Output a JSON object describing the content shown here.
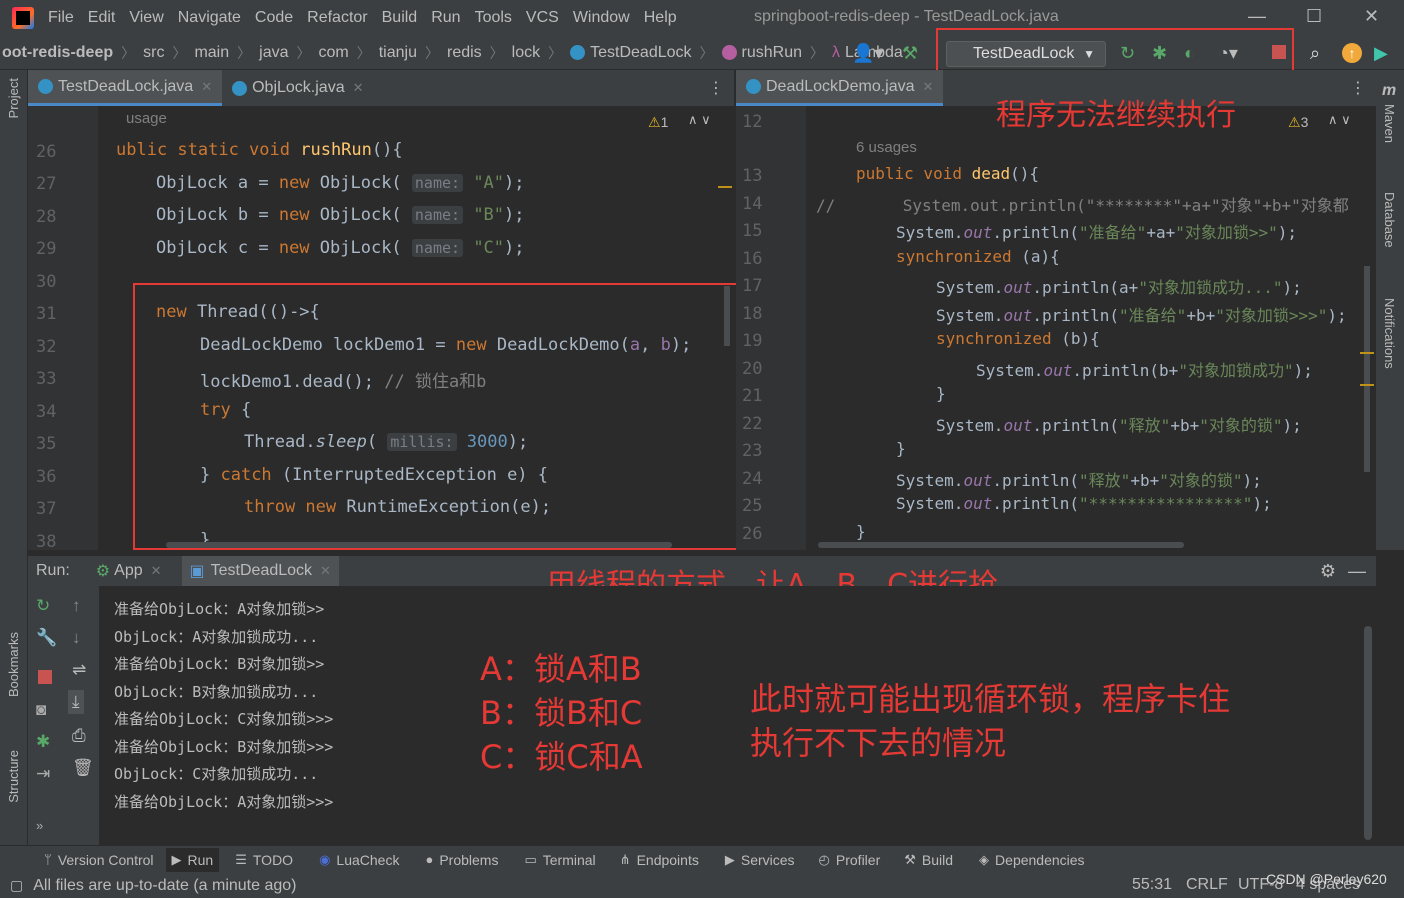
{
  "menu": {
    "items": [
      "File",
      "Edit",
      "View",
      "Navigate",
      "Code",
      "Refactor",
      "Build",
      "Run",
      "Tools",
      "VCS",
      "Window",
      "Help"
    ],
    "window_title": "springboot-redis-deep - TestDeadLock.java"
  },
  "breadcrumb": [
    "oot-redis-deep",
    "src",
    "main",
    "java",
    "com",
    "tianju",
    "redis",
    "lock",
    "TestDeadLock",
    "rushRun",
    "Lambda"
  ],
  "run_config": "TestDeadLock",
  "left_tabs": [
    {
      "label": "TestDeadLock.java"
    },
    {
      "label": "ObjLock.java"
    }
  ],
  "right_tabs": [
    {
      "label": "DeadLockDemo.java"
    }
  ],
  "left_editor": {
    "usage": "usage",
    "warn": "1",
    "lines": [
      "26",
      "27",
      "28",
      "29",
      "30",
      "31",
      "32",
      "33",
      "34",
      "35",
      "36",
      "37",
      "38"
    ]
  },
  "right_editor": {
    "usages": "6 usages",
    "warn": "3",
    "lines": [
      "12",
      "13",
      "14",
      "15",
      "16",
      "17",
      "18",
      "19",
      "20",
      "21",
      "22",
      "23",
      "24",
      "25",
      "26"
    ]
  },
  "annotations": {
    "top": "程序无法继续执行",
    "mid": "用线程的方式，让A、B、C进行抢",
    "a": "A：锁A和B",
    "b": "B：锁B和C",
    "c": "C：锁C和A",
    "note1": "此时就可能出现循环锁，程序卡住",
    "note2": "执行不下去的情况"
  },
  "run": {
    "label": "Run:",
    "tabs": [
      "App",
      "TestDeadLock"
    ]
  },
  "console": [
    "准备给ObjLock：A对象加锁>>",
    "ObjLock：A对象加锁成功...",
    "准备给ObjLock：B对象加锁>>",
    "ObjLock：B对象加锁成功...",
    "准备给ObjLock：C对象加锁>>>",
    "准备给ObjLock：B对象加锁>>>",
    "ObjLock：C对象加锁成功...",
    "准备给ObjLock：A对象加锁>>>"
  ],
  "bottom_tools": [
    "Version Control",
    "Run",
    "TODO",
    "LuaCheck",
    "Problems",
    "Terminal",
    "Endpoints",
    "Services",
    "Profiler",
    "Build",
    "Dependencies"
  ],
  "status": {
    "message": "All files are up-to-date (a minute ago)",
    "pos": "55:31",
    "eol": "CRLF",
    "enc": "UTF-8",
    "indent": "4 spaces",
    "watermark": "CSDN @Perley620"
  },
  "side": {
    "project": "Project",
    "bookmarks": "Bookmarks",
    "structure": "Structure",
    "maven": "Maven",
    "database": "Database",
    "notifications": "Notifications"
  }
}
